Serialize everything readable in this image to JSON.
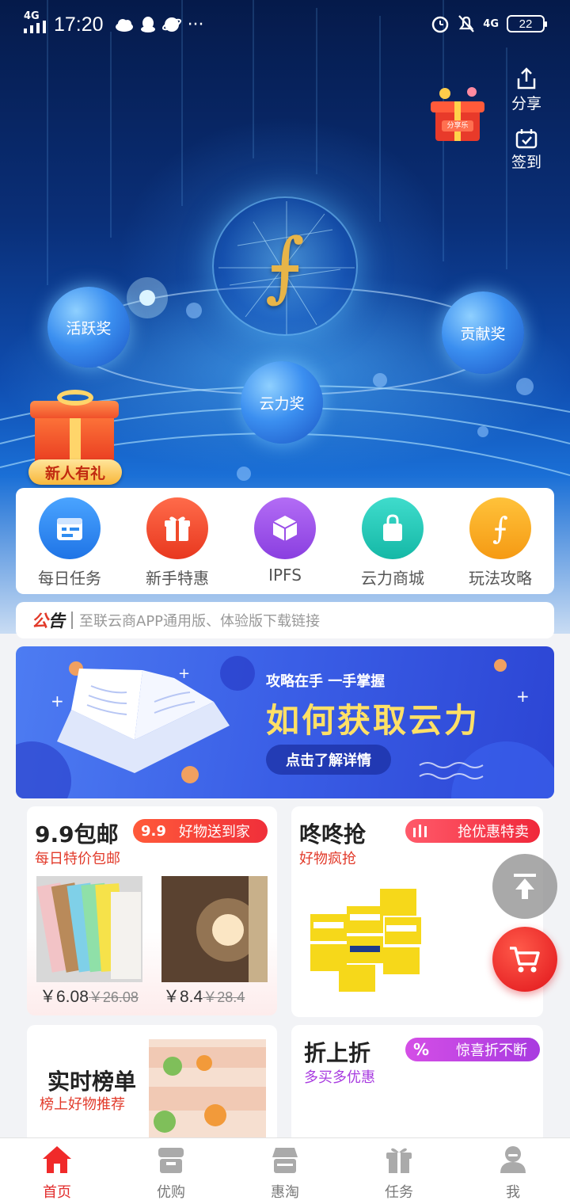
{
  "status_bar": {
    "network": "4G",
    "time": "17:20",
    "more": "···",
    "network_right": "4G",
    "battery": "22"
  },
  "hero": {
    "share_label": "分享",
    "checkin_label": "签到",
    "gift_badge": "分享乐",
    "orbs": {
      "active": "活跃奖",
      "contribution": "贡献奖",
      "cloud_power": "云力奖"
    },
    "newbie_label": "新人有礼",
    "accent_color": "#e8b548"
  },
  "menu": [
    {
      "label": "每日任务",
      "icon": "calendar-icon",
      "color": "#2f8cf0"
    },
    {
      "label": "新手特惠",
      "icon": "gift-icon",
      "color": "#f04a2a"
    },
    {
      "label": "IPFS",
      "icon": "cube-icon",
      "color": "#9a4ee8"
    },
    {
      "label": "云力商城",
      "icon": "shopping-bag-icon",
      "color": "#1cc7b6"
    },
    {
      "label": "玩法攻略",
      "icon": "filecoin-icon",
      "color": "#f5a21c"
    }
  ],
  "notice": {
    "tag_a": "公",
    "tag_b": "告",
    "text": "至联云商APP通用版、体验版下载链接"
  },
  "banner": {
    "subtitle": "攻略在手 一手掌握",
    "title": "如何获取云力",
    "button": "点击了解详情"
  },
  "tiles": {
    "free_shipping": {
      "title": "9.9包邮",
      "badge_num": "9.9",
      "badge": "好物送到家",
      "subtitle": "每日特价包邮",
      "products": [
        {
          "price": "￥6.08",
          "original": "￥26.08"
        },
        {
          "price": "￥8.4",
          "original": "￥28.4"
        }
      ]
    },
    "flash": {
      "title": "咚咚抢",
      "badge": "抢优惠特卖",
      "subtitle": "好物疯抢"
    },
    "ranking": {
      "title": "实时榜单",
      "subtitle": "榜上好物推荐"
    },
    "discount": {
      "title": "折上折",
      "badge_symbol": "%",
      "badge": "惊喜折不断",
      "subtitle": "多买多优惠"
    }
  },
  "bottom_nav": [
    {
      "label": "首页",
      "icon": "home-icon",
      "active": true
    },
    {
      "label": "优购",
      "icon": "store-icon",
      "active": false
    },
    {
      "label": "惠淘",
      "icon": "basket-icon",
      "active": false
    },
    {
      "label": "任务",
      "icon": "gift-icon",
      "active": false
    },
    {
      "label": "我",
      "icon": "user-icon",
      "active": false
    }
  ]
}
